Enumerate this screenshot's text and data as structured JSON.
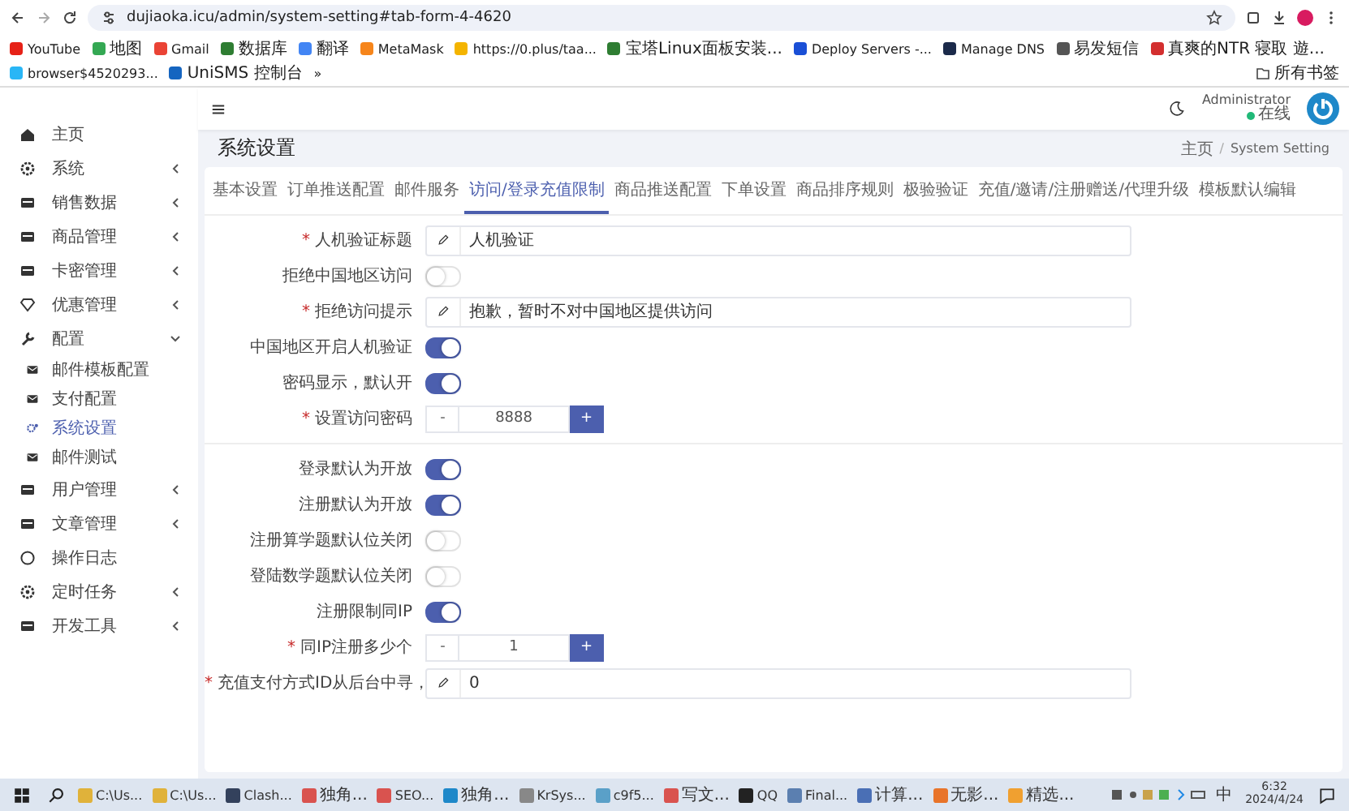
{
  "browser": {
    "url": "dujiaoka.icu/admin/system-setting#tab-form-4-4620",
    "bookmarks": [
      "YouTube",
      "地图",
      "Gmail",
      "数据库",
      "翻译",
      "MetaMask",
      "https://0.plus/taa...",
      "宝塔Linux面板安装...",
      "Deploy Servers -...",
      "Manage DNS",
      "易发短信",
      "真爽的NTR 寝取 遊...",
      "browser$4520293...",
      "UniSMS 控制台"
    ],
    "more": "»",
    "all_bookmarks": "所有书签"
  },
  "sidebar": {
    "items": [
      {
        "kind": "link",
        "label": "主页"
      },
      {
        "kind": "group",
        "label": "系统",
        "expanded": false
      },
      {
        "kind": "group",
        "label": "销售数据",
        "expanded": false
      },
      {
        "kind": "group",
        "label": "商品管理",
        "expanded": false
      },
      {
        "kind": "group",
        "label": "卡密管理",
        "expanded": false
      },
      {
        "kind": "group",
        "label": "优惠管理",
        "expanded": false
      },
      {
        "kind": "group",
        "label": "配置",
        "expanded": true,
        "children": [
          {
            "label": "邮件模板配置",
            "selected": false
          },
          {
            "label": "支付配置",
            "selected": false
          },
          {
            "label": "系统设置",
            "selected": true
          },
          {
            "label": "邮件测试",
            "selected": false
          }
        ]
      },
      {
        "kind": "group",
        "label": "用户管理",
        "expanded": false
      },
      {
        "kind": "group",
        "label": "文章管理",
        "expanded": false
      },
      {
        "kind": "link",
        "label": "操作日志"
      },
      {
        "kind": "group",
        "label": "定时任务",
        "expanded": false
      },
      {
        "kind": "group",
        "label": "开发工具",
        "expanded": false
      }
    ]
  },
  "header": {
    "user": "Administrator",
    "status": "在线"
  },
  "page": {
    "title": "系统设置",
    "breadcrumb": [
      "主页",
      "/",
      "System Setting"
    ]
  },
  "tabs": [
    {
      "label": "基本设置",
      "selected": false
    },
    {
      "label": "订单推送配置",
      "selected": false
    },
    {
      "label": "邮件服务",
      "selected": false
    },
    {
      "label": "访问/登录充值限制",
      "selected": true
    },
    {
      "label": "商品推送配置",
      "selected": false
    },
    {
      "label": "下单设置",
      "selected": false
    },
    {
      "label": "商品排序规则",
      "selected": false
    },
    {
      "label": "极验验证",
      "selected": false
    },
    {
      "label": "充值/邀请/注册赠送/代理升级",
      "selected": false
    },
    {
      "label": "模板默认编辑",
      "selected": false
    }
  ],
  "sections": [
    [
      {
        "kind": "text",
        "label": "人机验证标题",
        "required": "*",
        "value": "人机验证"
      },
      {
        "kind": "toggle",
        "label": "拒绝中国地区访问",
        "on": false
      },
      {
        "kind": "text",
        "label": "拒绝访问提示",
        "required": "*",
        "value": "抱歉，暂时不对中国地区提供访问"
      },
      {
        "kind": "toggle",
        "label": "中国地区开启人机验证",
        "on": true
      },
      {
        "kind": "toggle",
        "label": "密码显示，默认开",
        "on": true
      },
      {
        "kind": "stepper",
        "label": "设置访问密码",
        "required": "*",
        "value": "8888",
        "minus": "-",
        "plus": "+"
      }
    ],
    [
      {
        "kind": "toggle",
        "label": "登录默认为开放",
        "on": true
      },
      {
        "kind": "toggle",
        "label": "注册默认为开放",
        "on": true
      },
      {
        "kind": "toggle",
        "label": "注册算学题默认位关闭",
        "on": false
      },
      {
        "kind": "toggle",
        "label": "登陆数学题默认位关闭",
        "on": false
      },
      {
        "kind": "toggle",
        "label": "注册限制同IP",
        "on": true
      },
      {
        "kind": "stepper",
        "label": "同IP注册多少个",
        "required": "*",
        "value": "1",
        "minus": "-",
        "plus": "+"
      },
      {
        "kind": "text",
        "label": "充值支付方式ID从后台中寻，",
        "required": "*",
        "value": "0"
      }
    ]
  ],
  "taskbar": {
    "apps": [
      "C:\\Us...",
      "C:\\Us...",
      "Clash...",
      "独角...",
      "SEO...",
      "独角...",
      "KrSys...",
      "c9f5...",
      "写文...",
      "QQ",
      "Final...",
      "计算...",
      "无影...",
      "精选..."
    ],
    "ime": "中",
    "time": "6:32",
    "date": "2024/4/24"
  }
}
